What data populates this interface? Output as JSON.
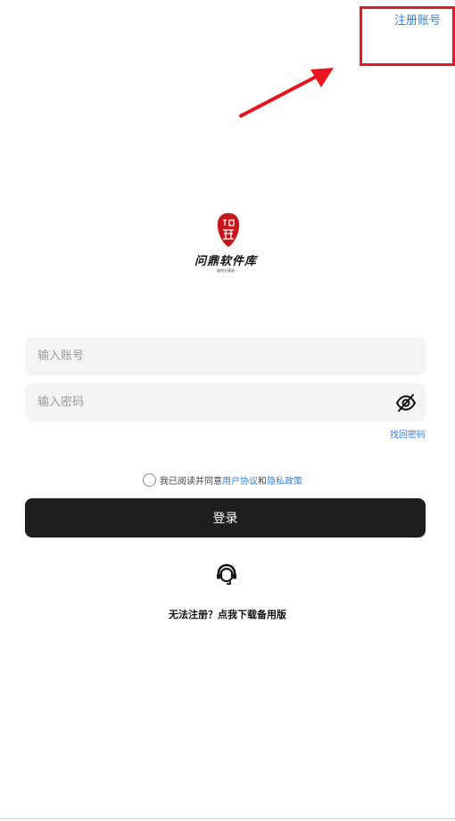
{
  "header": {
    "register_label": "注册账号"
  },
  "logo": {
    "seal_text": "问鼎",
    "name": "问鼎软件库",
    "subtitle": "软件分享站"
  },
  "form": {
    "account_placeholder": "输入账号",
    "password_placeholder": "输入密码",
    "forgot_label": "找回密码"
  },
  "agreement": {
    "prefix": "我已阅读并同意",
    "user_agreement": "用户协议",
    "conjunction": "和",
    "privacy_policy": "隐私政策"
  },
  "login_button_label": "登录",
  "support": {
    "icon": "headset-icon",
    "backup_label": "无法注册？点我下载备用版"
  },
  "annotation": {
    "highlight_color": "#e8141e"
  },
  "colors": {
    "link": "#2f7fd8",
    "button": "#1f1f1f",
    "input_bg": "#f4f4f4"
  }
}
